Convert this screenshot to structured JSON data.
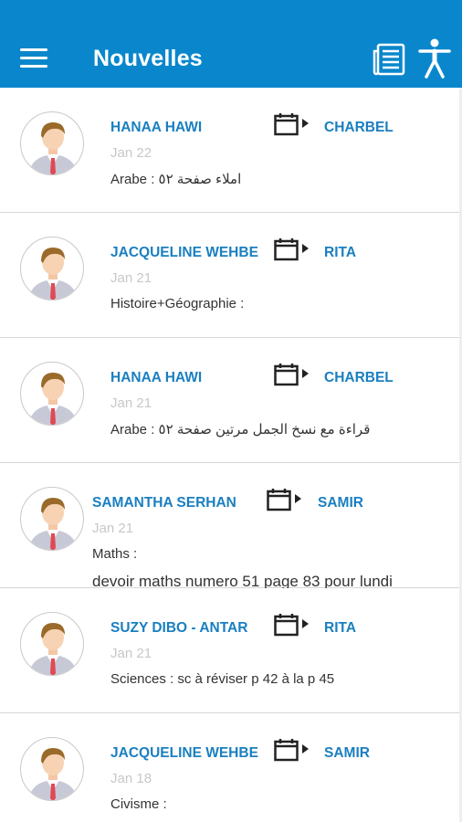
{
  "appbar": {
    "title": "Nouvelles"
  },
  "items": [
    {
      "sender": "HANAA HAWI",
      "recipient": "CHARBEL",
      "date": "Jan 22",
      "message": "Arabe : املاء صفحة ٥٢",
      "message2": ""
    },
    {
      "sender": "JACQUELINE WEHBE",
      "recipient": "RITA",
      "date": "Jan 21",
      "message": "Histoire+Géographie :",
      "message2": ""
    },
    {
      "sender": "HANAA HAWI",
      "recipient": "CHARBEL",
      "date": "Jan 21",
      "message": "Arabe : قراءة مع نسخ الجمل مرتين صفحة ٥٢",
      "message2": ""
    },
    {
      "sender": "SAMANTHA SERHAN",
      "recipient": "SAMIR",
      "date": "Jan 21",
      "message": "Maths :",
      "message2": "devoir maths numero 51 page 83 pour lundi"
    },
    {
      "sender": "SUZY DIBO - ANTAR",
      "recipient": "RITA",
      "date": "Jan 21",
      "message": "Sciences : sc à réviser p 42 à la p 45",
      "message2": ""
    },
    {
      "sender": "JACQUELINE WEHBE",
      "recipient": "SAMIR",
      "date": "Jan 18",
      "message": "Civisme :",
      "message2": ""
    }
  ],
  "icons": {
    "menu": "menu-icon",
    "news": "newspaper-icon",
    "accessibility": "accessibility-icon",
    "calendar": "calendar-arrow-icon",
    "avatar": "avatar-icon"
  },
  "colors": {
    "appbar": "#0a87cc",
    "accent": "#1a7fc0",
    "date": "#c8c8c8"
  }
}
